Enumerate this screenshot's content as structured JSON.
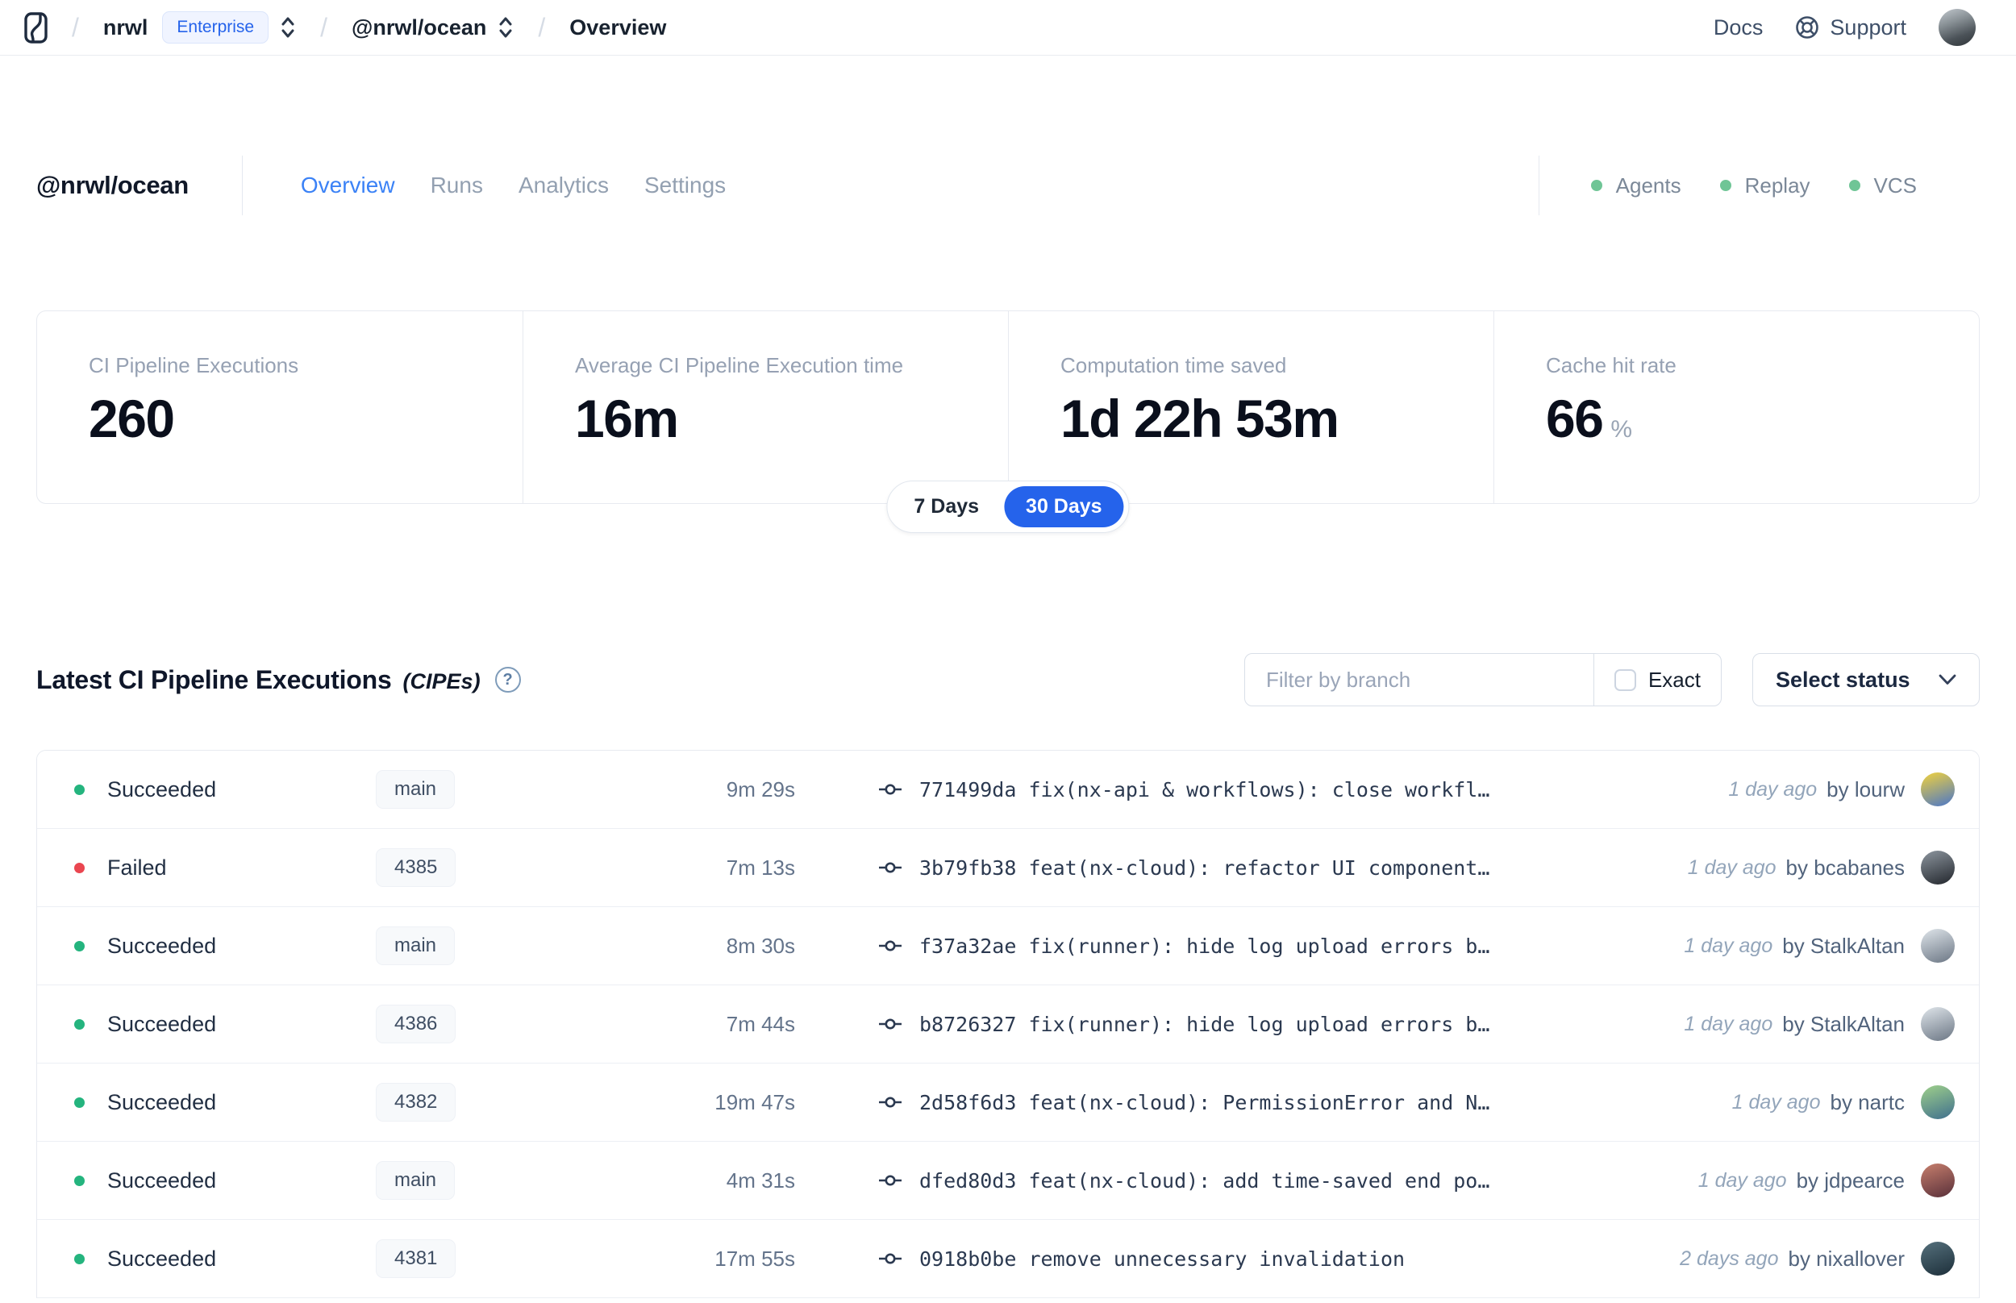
{
  "nav": {
    "separator": "/",
    "org": "nrwl",
    "plan_badge": "Enterprise",
    "workspace": "@nrwl/ocean",
    "page": "Overview",
    "docs_label": "Docs",
    "support_label": "Support"
  },
  "header": {
    "workspace": "@nrwl/ocean",
    "tabs": [
      {
        "label": "Overview",
        "active": true
      },
      {
        "label": "Runs",
        "active": false
      },
      {
        "label": "Analytics",
        "active": false
      },
      {
        "label": "Settings",
        "active": false
      }
    ],
    "statuses": [
      {
        "label": "Agents"
      },
      {
        "label": "Replay"
      },
      {
        "label": "VCS"
      }
    ]
  },
  "stats": {
    "cards": [
      {
        "label": "CI Pipeline Executions",
        "value": "260",
        "suffix": ""
      },
      {
        "label": "Average CI Pipeline Execution time",
        "value": "16m",
        "suffix": ""
      },
      {
        "label": "Computation time saved",
        "value": "1d 22h 53m",
        "suffix": ""
      },
      {
        "label": "Cache hit rate",
        "value": "66",
        "suffix": "%"
      }
    ],
    "range": {
      "options": [
        {
          "label": "7 Days",
          "active": false
        },
        {
          "label": "30 Days",
          "active": true
        }
      ]
    }
  },
  "cipes": {
    "title": "Latest CI Pipeline Executions",
    "title_suffix": "(CIPEs)",
    "help_glyph": "?",
    "filter_placeholder": "Filter by branch",
    "exact_label": "Exact",
    "status_dropdown": "Select status",
    "rows": [
      {
        "status": "Succeeded",
        "status_color": "green",
        "branch": "main",
        "duration": "9m 29s",
        "commit": "771499da fix(nx-api & workflows): close workfl…",
        "time": "1 day ago",
        "author": "by lourw",
        "avatar_colors": [
          "#f2d23c",
          "#4a76c9"
        ]
      },
      {
        "status": "Failed",
        "status_color": "red",
        "branch": "4385",
        "duration": "7m 13s",
        "commit": "3b79fb38 feat(nx-cloud): refactor UI component…",
        "time": "1 day ago",
        "author": "by bcabanes",
        "avatar_colors": [
          "#8d969f",
          "#22262c"
        ]
      },
      {
        "status": "Succeeded",
        "status_color": "green",
        "branch": "main",
        "duration": "8m 30s",
        "commit": "f37a32ae fix(runner): hide log upload errors b…",
        "time": "1 day ago",
        "author": "by StalkAltan",
        "avatar_colors": [
          "#dfe5ea",
          "#6b7684"
        ]
      },
      {
        "status": "Succeeded",
        "status_color": "green",
        "branch": "4386",
        "duration": "7m 44s",
        "commit": "b8726327 fix(runner): hide log upload errors b…",
        "time": "1 day ago",
        "author": "by StalkAltan",
        "avatar_colors": [
          "#dfe5ea",
          "#6b7684"
        ]
      },
      {
        "status": "Succeeded",
        "status_color": "green",
        "branch": "4382",
        "duration": "19m 47s",
        "commit": "2d58f6d3 feat(nx-cloud): PermissionError and N…",
        "time": "1 day ago",
        "author": "by nartc",
        "avatar_colors": [
          "#9fd08a",
          "#3f6f8e"
        ]
      },
      {
        "status": "Succeeded",
        "status_color": "green",
        "branch": "main",
        "duration": "4m 31s",
        "commit": "dfed80d3 feat(nx-cloud): add time-saved end po…",
        "time": "1 day ago",
        "author": "by jdpearce",
        "avatar_colors": [
          "#c77f6d",
          "#59303a"
        ]
      },
      {
        "status": "Succeeded",
        "status_color": "green",
        "branch": "4381",
        "duration": "17m 55s",
        "commit": "0918b0be remove unnecessary invalidation",
        "time": "2 days ago",
        "author": "by nixallover",
        "avatar_colors": [
          "#55707c",
          "#1d2f3a"
        ]
      }
    ]
  },
  "colors": {
    "accent_blue": "#2563eb",
    "tab_active": "#3b82f6",
    "header_status_green": "#6fc596",
    "succeeded": "#24b47e",
    "failed": "#ea4650"
  }
}
